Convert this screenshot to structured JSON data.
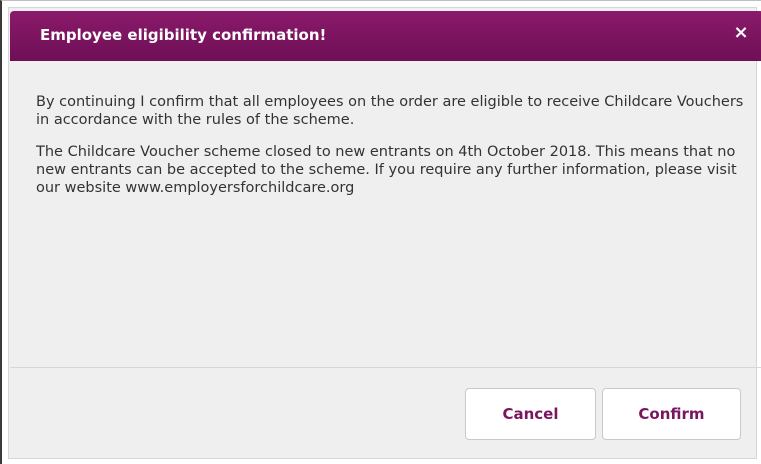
{
  "dialog": {
    "title": "Employee eligibility confirmation!",
    "close_icon": "×",
    "paragraphs": [
      "By continuing I confirm that all employees on the order are eligible to receive Childcare Vouchers in accordance with the rules of the scheme.",
      "The Childcare Voucher scheme closed to new entrants on 4th October 2018. This means that no new entrants can be accepted to the scheme. If you require any further information, please visit our website www.employersforchildcare.org"
    ],
    "buttons": {
      "cancel": "Cancel",
      "confirm": "Confirm"
    },
    "colors": {
      "header": "#7a1560",
      "body_bg": "#efefef",
      "button_text": "#7a1560"
    }
  }
}
